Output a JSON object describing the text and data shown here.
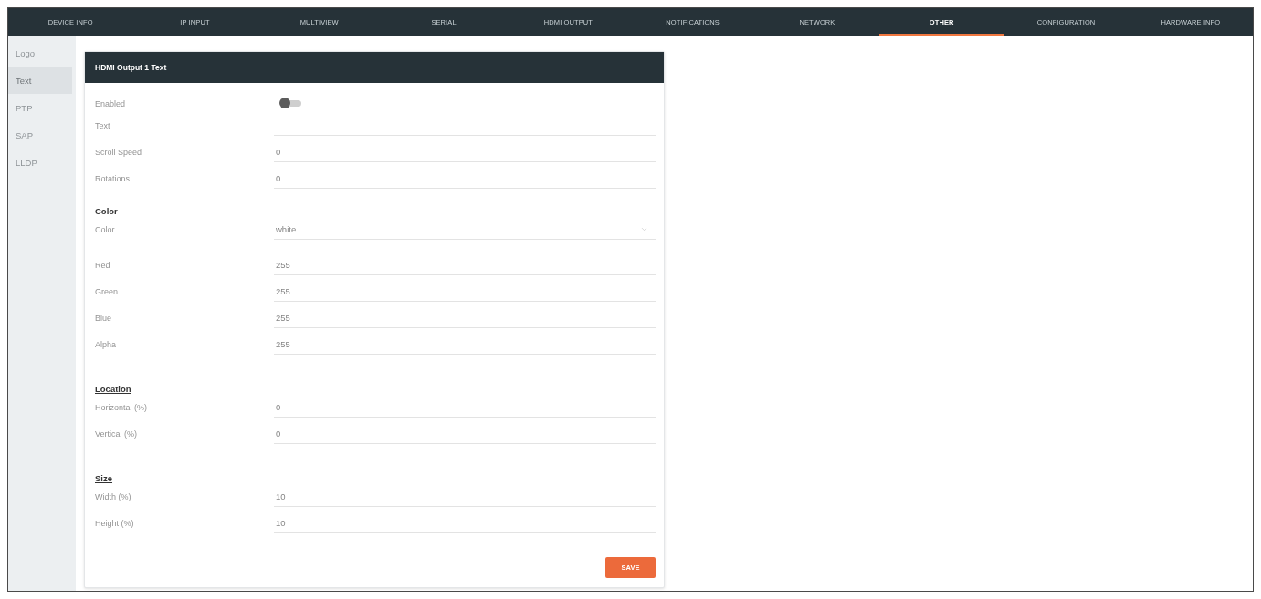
{
  "tabs": [
    {
      "label": "DEVICE INFO",
      "selected": false
    },
    {
      "label": "IP INPUT",
      "selected": false
    },
    {
      "label": "MULTIVIEW",
      "selected": false
    },
    {
      "label": "SERIAL",
      "selected": false
    },
    {
      "label": "HDMI OUTPUT",
      "selected": false
    },
    {
      "label": "NOTIFICATIONS",
      "selected": false
    },
    {
      "label": "NETWORK",
      "selected": false
    },
    {
      "label": "OTHER",
      "selected": true
    },
    {
      "label": "CONFIGURATION",
      "selected": false
    },
    {
      "label": "HARDWARE INFO",
      "selected": false
    }
  ],
  "sidebar": {
    "items": [
      {
        "label": "Logo",
        "selected": false
      },
      {
        "label": "Text",
        "selected": true
      },
      {
        "label": "PTP",
        "selected": false
      },
      {
        "label": "SAP",
        "selected": false
      },
      {
        "label": "LLDP",
        "selected": false
      }
    ]
  },
  "panel": {
    "title": "HDMI Output 1 Text",
    "sections": [
      {
        "rows": [
          {
            "kind": "toggle",
            "label": "Enabled",
            "on": false
          },
          {
            "kind": "input",
            "label": "Text"
          },
          {
            "kind": "input",
            "label": "Scroll Speed",
            "value": "0"
          },
          {
            "kind": "input",
            "label": "Rotations",
            "value": "0"
          }
        ]
      },
      {
        "heading": "Color",
        "underlined": false,
        "rows": [
          {
            "kind": "select",
            "label": "Color",
            "value": "white"
          }
        ]
      },
      {
        "rows": [
          {
            "kind": "input",
            "label": "Red",
            "value": "255"
          },
          {
            "kind": "input",
            "label": "Green",
            "value": "255"
          },
          {
            "kind": "input",
            "label": "Blue",
            "value": "255"
          },
          {
            "kind": "input",
            "label": "Alpha",
            "value": "255"
          }
        ]
      },
      {
        "heading": "Location",
        "underlined": true,
        "rows": [
          {
            "kind": "input",
            "label": "Horizontal (%)",
            "value": "0"
          },
          {
            "kind": "input",
            "label": "Vertical (%)",
            "value": "0"
          }
        ]
      },
      {
        "heading": "Size",
        "underlined": true,
        "rows": [
          {
            "kind": "input",
            "label": "Width (%)",
            "value": "10"
          },
          {
            "kind": "input",
            "label": "Height (%)",
            "value": "10"
          }
        ]
      }
    ],
    "save_button": "SAVE"
  }
}
